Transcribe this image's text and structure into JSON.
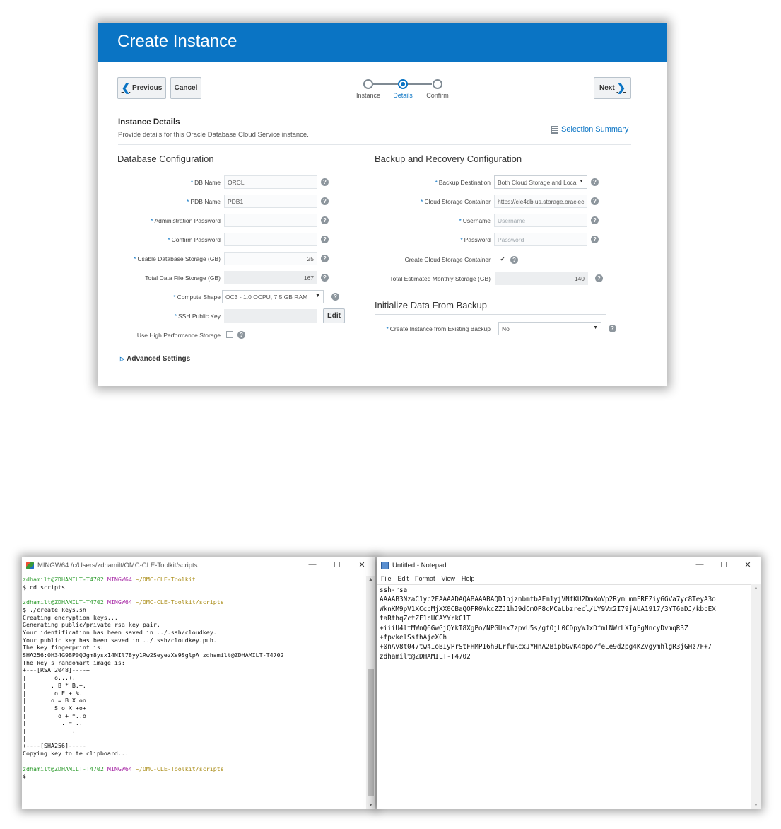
{
  "oracle": {
    "title": "Create Instance",
    "buttons": {
      "previous": "Previous",
      "cancel": "Cancel",
      "next": "Next"
    },
    "train": [
      "Instance",
      "Details",
      "Confirm"
    ],
    "train_active": "Details",
    "section_title": "Instance Details",
    "section_desc": "Provide details for this Oracle Database Cloud Service instance.",
    "selection_summary": "Selection Summary",
    "db_config": {
      "heading": "Database Configuration",
      "db_name_label": "DB Name",
      "db_name_value": "ORCL",
      "pdb_name_label": "PDB Name",
      "pdb_name_value": "PDB1",
      "admin_pw_label": "Administration Password",
      "confirm_pw_label": "Confirm Password",
      "usable_storage_label": "Usable Database Storage (GB)",
      "usable_storage_value": "25",
      "total_file_label": "Total Data File Storage (GB)",
      "total_file_value": "167",
      "compute_shape_label": "Compute Shape",
      "compute_shape_value": "OC3 - 1.0 OCPU, 7.5 GB RAM",
      "ssh_key_label": "SSH Public Key",
      "edit_button": "Edit",
      "high_perf_label": "Use High Performance Storage"
    },
    "advanced_settings": "Advanced Settings",
    "backup": {
      "heading": "Backup and Recovery Configuration",
      "dest_label": "Backup Destination",
      "dest_value": "Both Cloud Storage and Loca",
      "container_label": "Cloud Storage Container",
      "container_value": "https://cle4db.us.storage.oraclec",
      "username_label": "Username",
      "username_placeholder": "Username",
      "password_label": "Password",
      "password_placeholder": "Password",
      "create_container_label": "Create Cloud Storage Container",
      "create_container_checked": "✔",
      "monthly_label": "Total Estimated Monthly Storage (GB)",
      "monthly_value": "140"
    },
    "init": {
      "heading": "Initialize Data From Backup",
      "existing_label": "Create Instance from Existing Backup",
      "existing_value": "No"
    }
  },
  "terminal": {
    "title": "MINGW64:/c/Users/zdhamilt/OMC-CLE-Toolkit/scripts",
    "prompt_user": "zdhamilt@ZDHAMILT-T4702",
    "prompt_env": "MINGW64",
    "path1": "~/OMC-CLE-Toolkit",
    "path2": "~/OMC-CLE-Toolkit/scripts",
    "cmd1": "$ cd scripts",
    "cmd2": "$ ./create_keys.sh",
    "output": [
      "Creating encryption keys...",
      "Generating public/private rsa key pair.",
      "Your identification has been saved in ../.ssh/cloudkey.",
      "Your public key has been saved in ../.ssh/cloudkey.pub.",
      "The key fingerprint is:",
      "SHA256:0H34G9BP0QJgm8ysx14NIl78yy1Rw2SeyezXs9SglpA zdhamilt@ZDHAMILT-T4702",
      "The key's randomart image is:",
      "+---[RSA 2048]----+",
      "|        o...+. |",
      "|       . B * B.+.|",
      "|      . o E + %. |",
      "|       o = B X oo|",
      "|        S o X +o+|",
      "|         o + *..o|",
      "|          . = .. |",
      "|             .   |",
      "|                 |",
      "+----[SHA256]-----+",
      "Copying key to te clipboard..."
    ],
    "final_prompt": "$ "
  },
  "notepad": {
    "title": "Untitled - Notepad",
    "menu": [
      "File",
      "Edit",
      "Format",
      "View",
      "Help"
    ],
    "lines": [
      "ssh-rsa",
      "AAAAB3NzaC1yc2EAAAADAQABAAABAQD1pjznbmtbAFm1yjVNfKU2DmXoVp2RymLmmFRFZiyGGVa7yc8TeyA3o",
      "WknKM9pV1XCccMjXX0CBaQOFR0WkcZZJ1hJ9dCmOP8cMCaLbzrecl/LY9Vx2I79jAUA1917/3YT6aDJ/kbcEX",
      "taRthqZctZF1cUCAYYrkC1T",
      "+iiiU4ltMWnQ6GwGjQYkI8XgPo/NPGUax7zpvU5s/gfOjL0CDpyWJxDfmlNWrLXIgFgNncyDvmqR3Z",
      "+fpvkelSsfhAjeXCh",
      "+0nAv8t047tw4IoBIyPrStFHMP16h9LrfuRcxJYHnA2BipbGvK4opo7feLe9d2pg4KZvgymhlgR3jGHz7F+/",
      "zdhamilt@ZDHAMILT-T4702"
    ]
  }
}
